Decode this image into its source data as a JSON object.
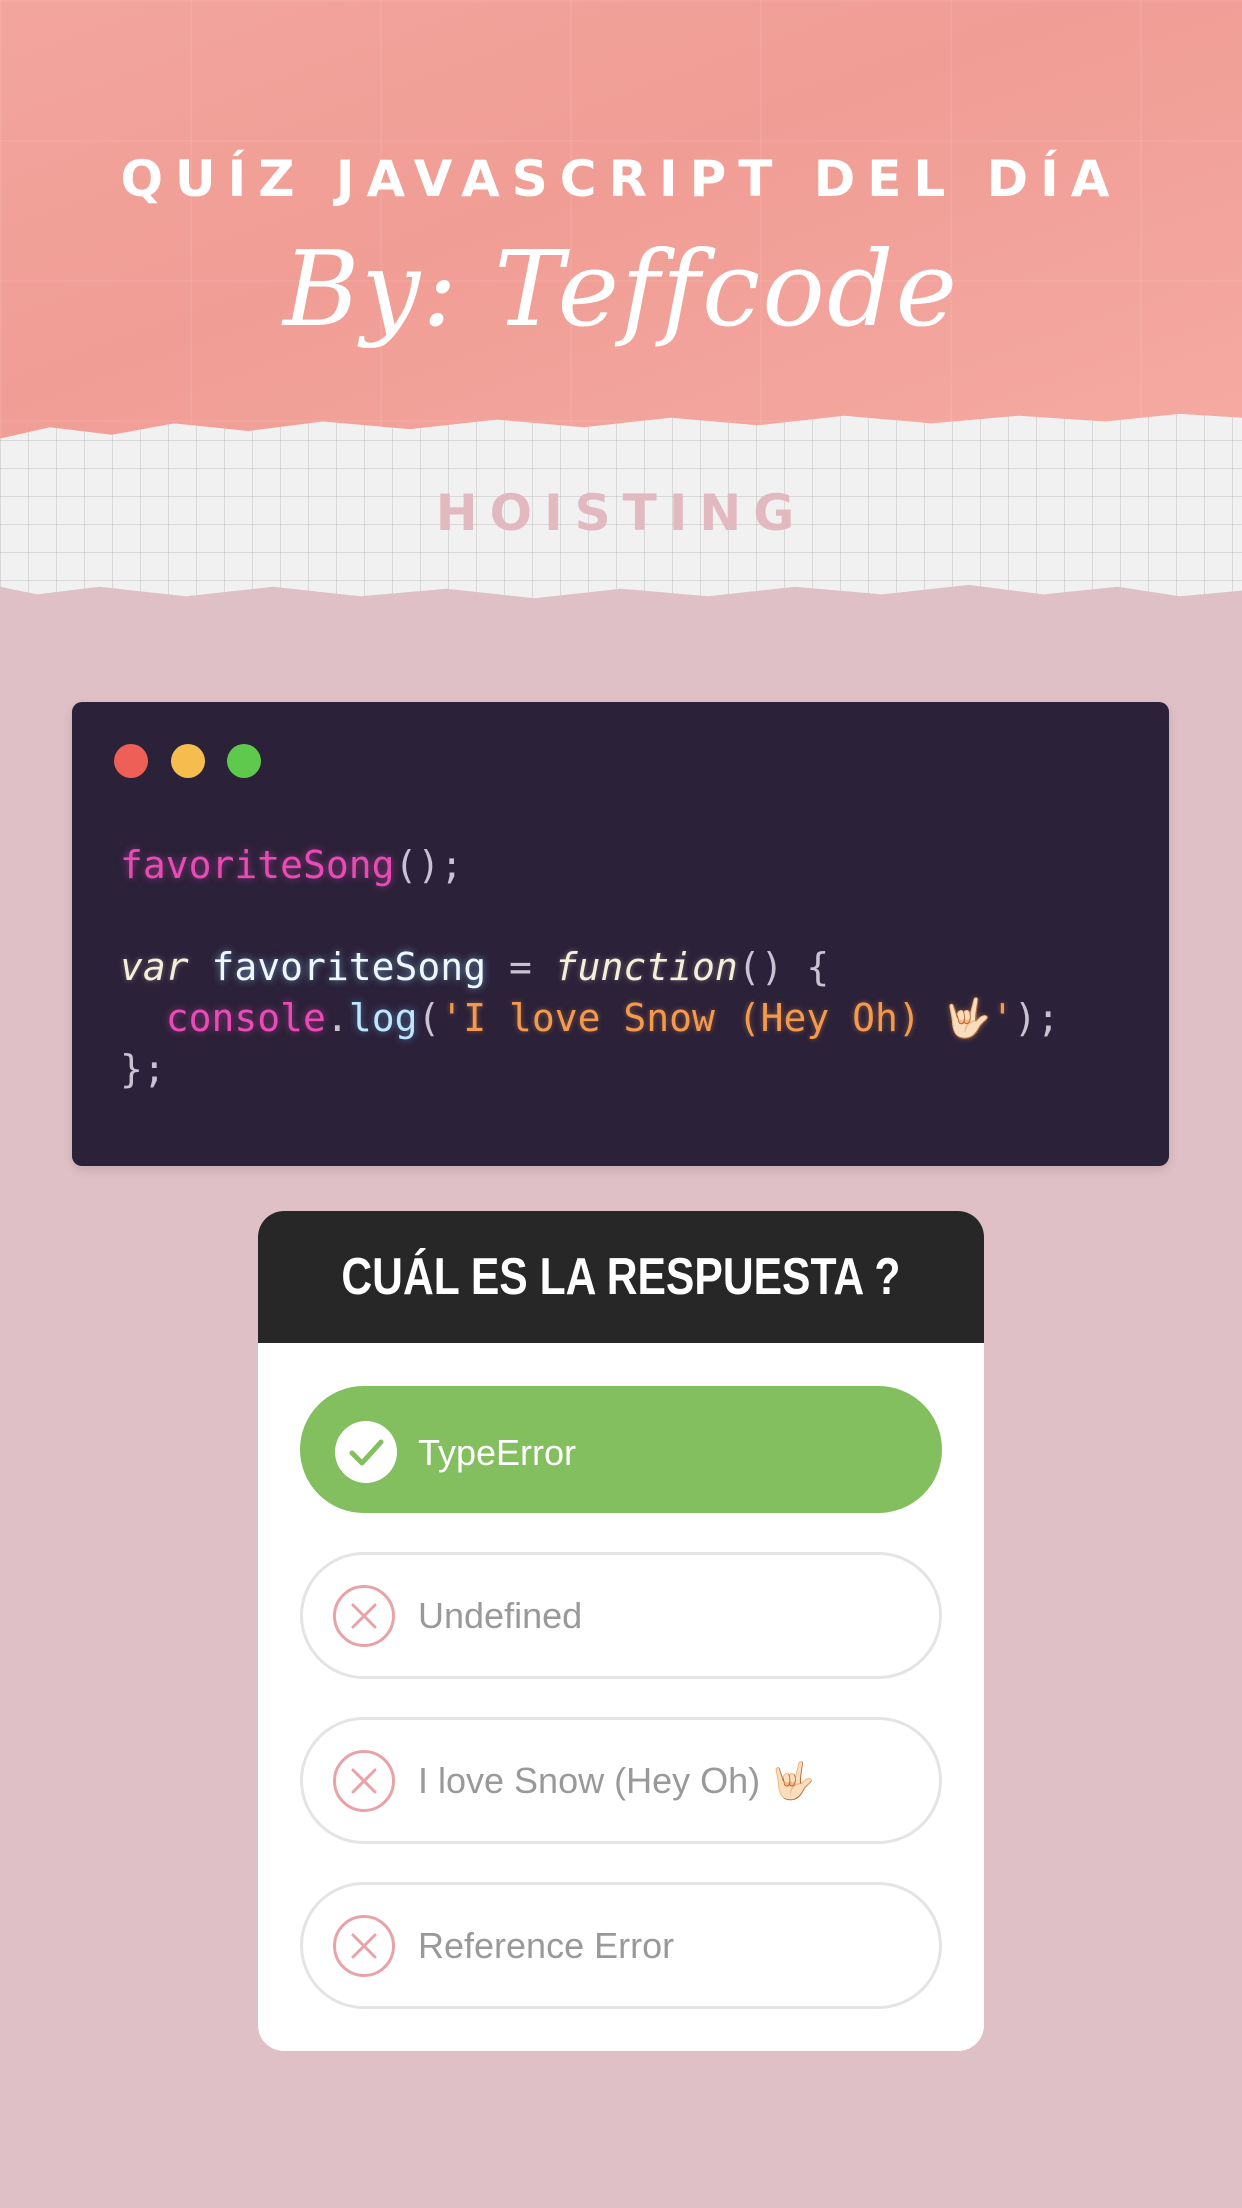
{
  "header": {
    "eyebrow": "QUÍZ JAVASCRIPT DEL DÍA",
    "byline": "By: Teffcode",
    "topic": "HOISTING"
  },
  "code_window": {
    "lines": [
      [
        {
          "t": "favoriteSong",
          "c": "fn"
        },
        {
          "t": "();",
          "c": "punc"
        }
      ],
      [],
      [
        {
          "t": "var",
          "c": "kw"
        },
        {
          "t": " ",
          "c": "punc"
        },
        {
          "t": "favoriteSong",
          "c": "id"
        },
        {
          "t": " = ",
          "c": "punc"
        },
        {
          "t": "function",
          "c": "kw"
        },
        {
          "t": "() {",
          "c": "punc"
        }
      ],
      [
        {
          "t": "  ",
          "c": "punc"
        },
        {
          "t": "console",
          "c": "fn"
        },
        {
          "t": ".",
          "c": "punc"
        },
        {
          "t": "log",
          "c": "call"
        },
        {
          "t": "(",
          "c": "punc"
        },
        {
          "t": "'I love Snow (Hey Oh) 🤟🏻'",
          "c": "str"
        },
        {
          "t": ");",
          "c": "punc"
        }
      ],
      [
        {
          "t": "};",
          "c": "punc"
        }
      ]
    ]
  },
  "quiz": {
    "title": "CUÁL ES LA RESPUESTA ?",
    "options": [
      {
        "label": "TypeError",
        "state": "correct"
      },
      {
        "label": "Undefined",
        "state": "wrong"
      },
      {
        "label": "I love Snow (Hey Oh) 🤟🏻",
        "state": "wrong"
      },
      {
        "label": "Reference Error",
        "state": "wrong"
      }
    ]
  },
  "colors": {
    "background": "#dfc0c6",
    "header": "#f09d95",
    "correct": "#83bf5e",
    "wrong_icon": "#e9a2a6"
  },
  "icons": {
    "correct": "check-icon",
    "wrong": "x-circle-icon"
  }
}
